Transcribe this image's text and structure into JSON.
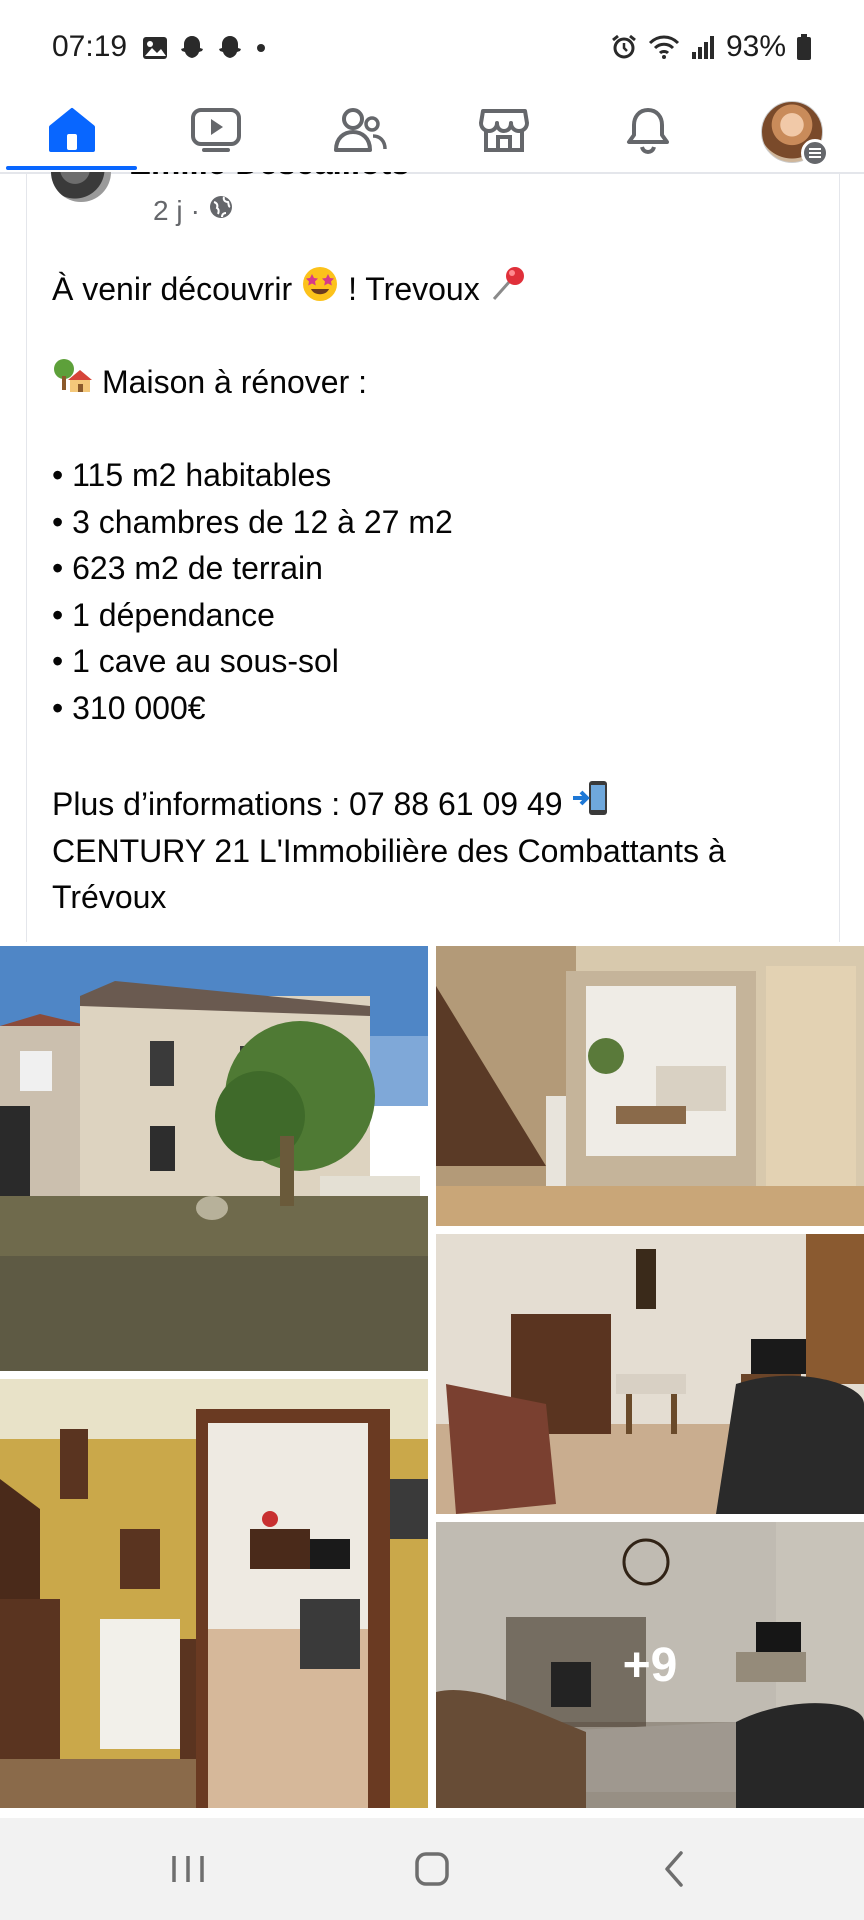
{
  "status_bar": {
    "time": "07:19",
    "battery": "93%",
    "left_icons": [
      "gallery-icon",
      "snapchat-icon",
      "snapchat-icon",
      "dot-icon"
    ],
    "right_icons": [
      "alarm-icon",
      "wifi-icon",
      "signal-icon",
      "battery-icon"
    ]
  },
  "nav": {
    "tabs": [
      {
        "name": "home",
        "icon": "home-icon",
        "active": true
      },
      {
        "name": "watch",
        "icon": "video-icon",
        "active": false
      },
      {
        "name": "friends",
        "icon": "friends-icon",
        "active": false
      },
      {
        "name": "marketplace",
        "icon": "marketplace-icon",
        "active": false
      },
      {
        "name": "notifications",
        "icon": "bell-icon",
        "active": false
      },
      {
        "name": "menu",
        "icon": "avatar",
        "active": false
      }
    ],
    "accent": "#0866ff"
  },
  "post": {
    "author": "Emilie Descaillots",
    "time": "2 j",
    "audience_icon": "globe-icon",
    "line1_a": "À venir découvrir",
    "line1_b": "! Trevoux",
    "line2": "Maison à rénover :",
    "bullets": [
      "• 115 m2 habitables",
      "• 3 chambres de 12 à 27 m2",
      "• 623 m2 de terrain",
      "• 1 dépendance",
      "• 1 cave au sous-sol",
      "• 310 000€"
    ],
    "contact_line": "Plus d’informations : 07 88 61 09 49",
    "agency_line1": "CENTURY 21 L'Immobilière des Combattants à",
    "agency_line2": "Trévoux",
    "more_photos": "+9"
  },
  "colors": {
    "secondary_text": "#65676b",
    "divider": "#e4e6eb"
  }
}
